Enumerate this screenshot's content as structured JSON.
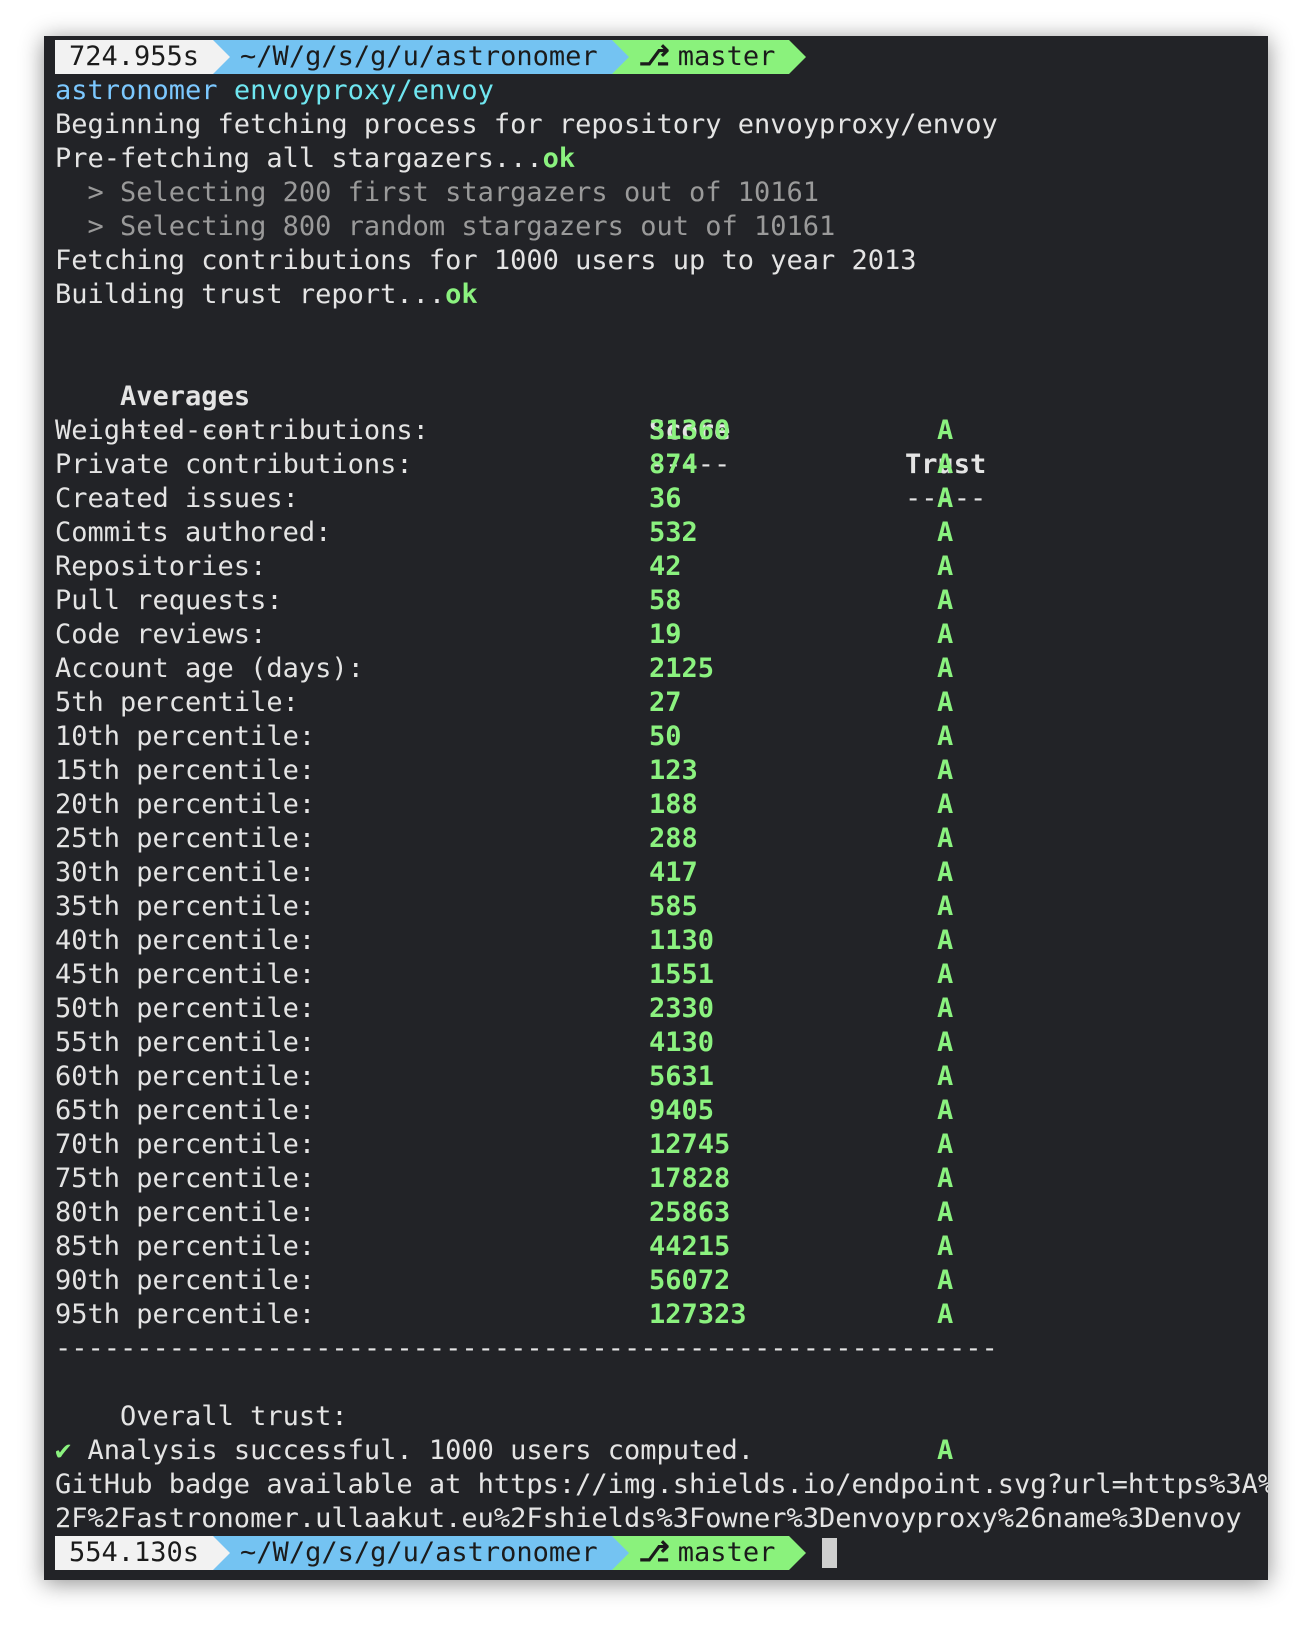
{
  "prompt_top": {
    "time": "724.955s",
    "path": "~/W/g/s/g/u/astronomer",
    "branch": "master"
  },
  "command": {
    "program": "astronomer",
    "argument": "envoyproxy/envoy"
  },
  "log": {
    "beginning": "Beginning fetching process for repository envoyproxy/envoy",
    "prefetch": "Pre-fetching all stargazers...",
    "prefetch_ok": "ok",
    "select_first": "  > Selecting 200 first stargazers out of 10161",
    "select_random": "  > Selecting 800 random stargazers out of 10161",
    "fetching": "Fetching contributions for 1000 users up to year 2013",
    "building": "Building trust report...",
    "building_ok": "ok"
  },
  "table": {
    "headers": {
      "label": "Averages",
      "score": "Score",
      "trust": "Trust"
    },
    "underlines": {
      "label": "--------",
      "score": "-----",
      "trust": "-----"
    },
    "rows": [
      {
        "label": "Weighted contributions:",
        "score": "31360",
        "trust": "A"
      },
      {
        "label": "Private contributions:",
        "score": "874",
        "trust": "A"
      },
      {
        "label": "Created issues:",
        "score": "36",
        "trust": "A"
      },
      {
        "label": "Commits authored:",
        "score": "532",
        "trust": "A"
      },
      {
        "label": "Repositories:",
        "score": "42",
        "trust": "A"
      },
      {
        "label": "Pull requests:",
        "score": "58",
        "trust": "A"
      },
      {
        "label": "Code reviews:",
        "score": "19",
        "trust": "A"
      },
      {
        "label": "Account age (days):",
        "score": "2125",
        "trust": "A"
      },
      {
        "label": "5th percentile:",
        "score": "27",
        "trust": "A"
      },
      {
        "label": "10th percentile:",
        "score": "50",
        "trust": "A"
      },
      {
        "label": "15th percentile:",
        "score": "123",
        "trust": "A"
      },
      {
        "label": "20th percentile:",
        "score": "188",
        "trust": "A"
      },
      {
        "label": "25th percentile:",
        "score": "288",
        "trust": "A"
      },
      {
        "label": "30th percentile:",
        "score": "417",
        "trust": "A"
      },
      {
        "label": "35th percentile:",
        "score": "585",
        "trust": "A"
      },
      {
        "label": "40th percentile:",
        "score": "1130",
        "trust": "A"
      },
      {
        "label": "45th percentile:",
        "score": "1551",
        "trust": "A"
      },
      {
        "label": "50th percentile:",
        "score": "2330",
        "trust": "A"
      },
      {
        "label": "55th percentile:",
        "score": "4130",
        "trust": "A"
      },
      {
        "label": "60th percentile:",
        "score": "5631",
        "trust": "A"
      },
      {
        "label": "65th percentile:",
        "score": "9405",
        "trust": "A"
      },
      {
        "label": "70th percentile:",
        "score": "12745",
        "trust": "A"
      },
      {
        "label": "75th percentile:",
        "score": "17828",
        "trust": "A"
      },
      {
        "label": "80th percentile:",
        "score": "25863",
        "trust": "A"
      },
      {
        "label": "85th percentile:",
        "score": "44215",
        "trust": "A"
      },
      {
        "label": "90th percentile:",
        "score": "56072",
        "trust": "A"
      },
      {
        "label": "95th percentile:",
        "score": "127323",
        "trust": "A"
      }
    ],
    "separator": "----------------------------------------------------------",
    "overall_label": "Overall trust:",
    "overall_grade": "A"
  },
  "result": {
    "check": "✔",
    "success": "Analysis successful. 1000 users computed.",
    "badge_line1": "GitHub badge available at https://img.shields.io/endpoint.svg?url=https%3A%",
    "badge_line2": "2F%2Fastronomer.ullaakut.eu%2Fshields%3Fowner%3Denvoyproxy%26name%3Denvoy"
  },
  "prompt_bottom": {
    "time": "554.130s",
    "path": "~/W/g/s/g/u/astronomer",
    "branch": "master"
  },
  "colors": {
    "background": "#222327",
    "text": "#e4e4e4",
    "accent_green": "#8bf27f",
    "prompt_time_bg": "#f2f2f2",
    "prompt_path_bg": "#74c3f2",
    "prompt_git_bg": "#8af27c",
    "command_program": "#7cc8ff",
    "command_argument": "#6fe6f0"
  }
}
